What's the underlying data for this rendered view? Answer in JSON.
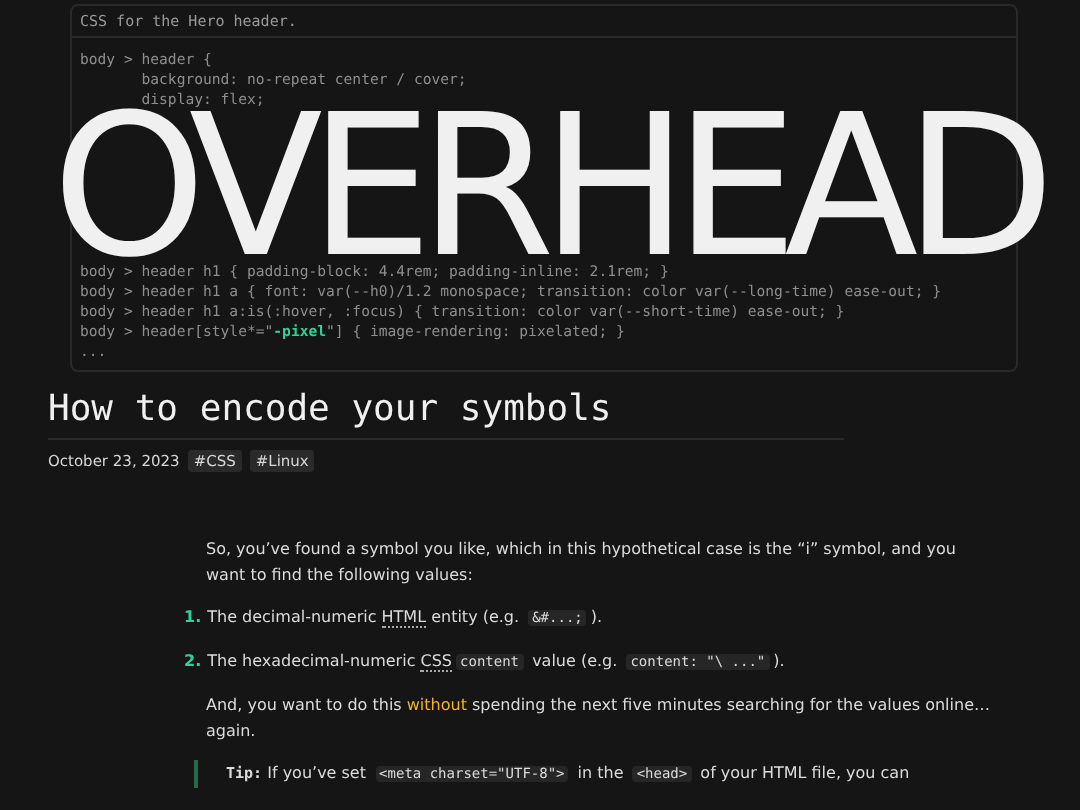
{
  "code_block": {
    "caption": "CSS for the Hero header.",
    "lines_top": [
      [
        {
          "kind": "plain",
          "text": "body > header {"
        }
      ],
      [
        {
          "kind": "plain",
          "text": "       background: no-repeat center / cover;"
        }
      ],
      [
        {
          "kind": "plain",
          "text": "       display: flex;"
        }
      ]
    ],
    "lines_bottom": [
      [
        {
          "kind": "plain",
          "text": "body > header h1 { padding-block: 4.4rem; padding-inline: 2.1rem; }"
        }
      ],
      [
        {
          "kind": "plain",
          "text": "body > header h1 a { font: var(--h0)/1.2 monospace; transition: color var(--long-time) ease-out; }"
        }
      ],
      [
        {
          "kind": "plain",
          "text": "body > header h1 a:is(:hover, :focus) { transition: color var(--short-time) ease-out; }"
        }
      ],
      [
        {
          "kind": "plain",
          "text": "body > header[style*=\""
        },
        {
          "kind": "string",
          "text": "-pixel"
        },
        {
          "kind": "plain",
          "text": "\"] { image-rendering: pixelated; }"
        }
      ],
      [
        {
          "kind": "plain",
          "text": "..."
        }
      ]
    ]
  },
  "site_title": "OVERHEAD",
  "article": {
    "title": "How to encode your symbols",
    "date": "October 23, 2023",
    "tags": [
      "#CSS",
      "#Linux"
    ],
    "blocks": [
      {
        "kind": "paragraph",
        "segments": [
          {
            "kind": "text",
            "text": "So, you’ve found a symbol you like, which in this hypothetical case is the “i” symbol, and you want to find the following values:"
          }
        ]
      },
      {
        "kind": "item",
        "marker": "1.",
        "segments": [
          {
            "kind": "text",
            "text": "The decimal-numeric "
          },
          {
            "kind": "abbr",
            "text": "HTML"
          },
          {
            "kind": "text",
            "text": " entity (e.g. "
          },
          {
            "kind": "code",
            "text": "&#...;"
          },
          {
            "kind": "text",
            "text": ")."
          }
        ]
      },
      {
        "kind": "item",
        "marker": "2.",
        "segments": [
          {
            "kind": "text",
            "text": "The hexadecimal-numeric "
          },
          {
            "kind": "abbr",
            "text": "CSS"
          },
          {
            "kind": "code",
            "text": "content"
          },
          {
            "kind": "text",
            "text": " value (e.g. "
          },
          {
            "kind": "code",
            "text": "content: \"\\ ...\""
          },
          {
            "kind": "text",
            "text": ")."
          }
        ]
      },
      {
        "kind": "paragraph",
        "segments": [
          {
            "kind": "text",
            "text": "And, you want to do this "
          },
          {
            "kind": "highlight",
            "text": "without"
          },
          {
            "kind": "text",
            "text": " spending the next five minutes searching for the values online… again."
          }
        ]
      },
      {
        "kind": "tip",
        "segments": [
          {
            "kind": "label",
            "text": "Tip:"
          },
          {
            "kind": "text",
            "text": " If you’ve set "
          },
          {
            "kind": "code",
            "text": "<meta charset=\"UTF-8\">"
          },
          {
            "kind": "text",
            "text": " in the "
          },
          {
            "kind": "code",
            "text": "<head>"
          },
          {
            "kind": "text",
            "text": " of your HTML file, you can"
          }
        ]
      }
    ]
  }
}
